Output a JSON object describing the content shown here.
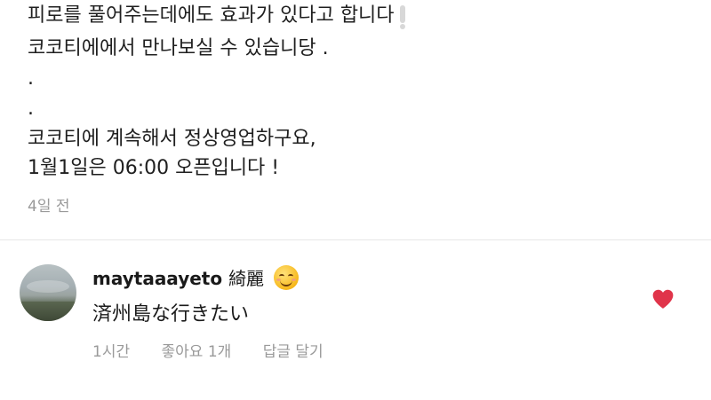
{
  "post": {
    "caption_lines": [
      "피로를 풀어주는데에도 효과가 있다고 합니다",
      "코코티에에서 만나보실 수 있습니당 .",
      ".",
      ".",
      "코코티에 계속해서 정상영업하구요,",
      "1월1일은 06:00 오픈입니다 !"
    ],
    "time": "4일 전"
  },
  "comment": {
    "username": "maytaaayeto",
    "username_text": "綺麗",
    "emoji": "smiling-face-emoji",
    "text": "済州島な行きたい",
    "time": "1시간",
    "likes": "좋아요 1개",
    "reply_label": "답글 달기",
    "liked": true,
    "heart_color": "#e0344a"
  }
}
